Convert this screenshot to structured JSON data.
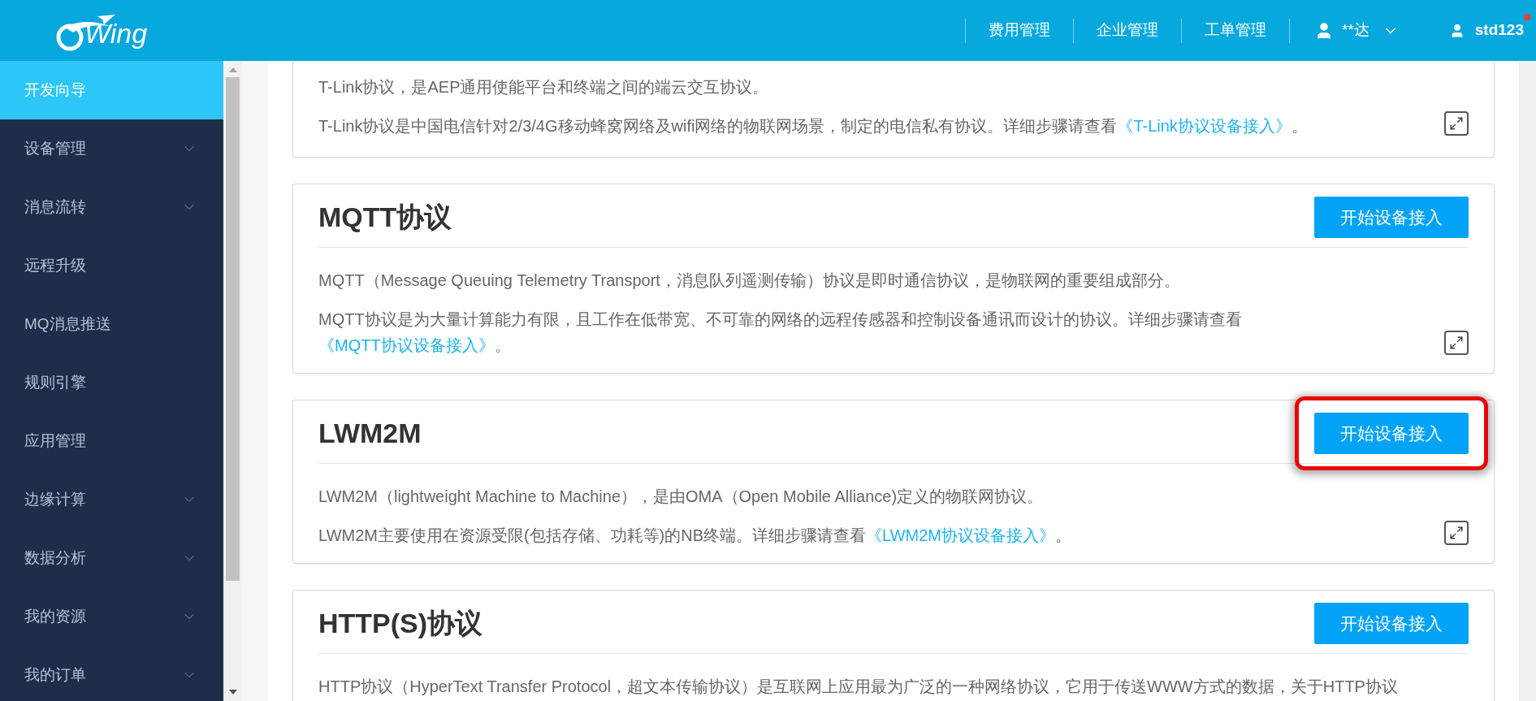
{
  "header": {
    "logo": {
      "text": "Wing"
    },
    "nav": [
      {
        "label": "费用管理"
      },
      {
        "label": "企业管理"
      },
      {
        "label": "工单管理"
      }
    ],
    "account": {
      "name": "**达"
    },
    "user": {
      "name": "std123",
      "has_notification": true
    }
  },
  "sidebar": {
    "items": [
      {
        "label": "开发向导",
        "selected": true,
        "expandable": false
      },
      {
        "label": "设备管理",
        "selected": false,
        "expandable": true
      },
      {
        "label": "消息流转",
        "selected": false,
        "expandable": true
      },
      {
        "label": "远程升级",
        "selected": false,
        "expandable": false
      },
      {
        "label": "MQ消息推送",
        "selected": false,
        "expandable": false
      },
      {
        "label": "规则引擎",
        "selected": false,
        "expandable": false
      },
      {
        "label": "应用管理",
        "selected": false,
        "expandable": false
      },
      {
        "label": "边缘计算",
        "selected": false,
        "expandable": true
      },
      {
        "label": "数据分析",
        "selected": false,
        "expandable": true
      },
      {
        "label": "我的资源",
        "selected": false,
        "expandable": true
      },
      {
        "label": "我的订单",
        "selected": false,
        "expandable": true
      }
    ]
  },
  "cards": [
    {
      "paragraphs": [
        {
          "text": "T-Link协议，是AEP通用使能平台和终端之间的端云交互协议。"
        },
        {
          "text": "T-Link协议是中国电信针对2/3/4G移动蜂窝网络及wifi网络的物联网场景，制定的电信私有协议。详细步骤请查看",
          "link": "《T-Link协议设备接入》",
          "after": "。"
        }
      ]
    },
    {
      "title": "MQTT协议",
      "button": {
        "label": "开始设备接入",
        "highlighted": false
      },
      "paragraphs": [
        {
          "text": "MQTT（Message Queuing Telemetry Transport，消息队列遥测传输）协议是即时通信协议，是物联网的重要组成部分。"
        },
        {
          "text": "MQTT协议是为大量计算能力有限，且工作在低带宽、不可靠的网络的远程传感器和控制设备通讯而设计的协议。详细步骤请查看",
          "link": "《MQTT协议设备接入》",
          "after": "。"
        }
      ]
    },
    {
      "title": "LWM2M",
      "button": {
        "label": "开始设备接入",
        "highlighted": true
      },
      "paragraphs": [
        {
          "text": "LWM2M（lightweight Machine to Machine），是由OMA（Open Mobile Alliance)定义的物联网协议。"
        },
        {
          "text": "LWM2M主要使用在资源受限(包括存储、功耗等)的NB终端。详细步骤请查看",
          "link": "《LWM2M协议设备接入》",
          "after": "。"
        }
      ]
    },
    {
      "title": "HTTP(S)协议",
      "button": {
        "label": "开始设备接入",
        "highlighted": false
      },
      "paragraphs": [
        {
          "text": "HTTP协议（HyperText Transfer Protocol，超文本传输协议）是互联网上应用最为广泛的一种网络协议，它用于传送WWW方式的数据，关于HTTP协议"
        }
      ]
    }
  ]
}
